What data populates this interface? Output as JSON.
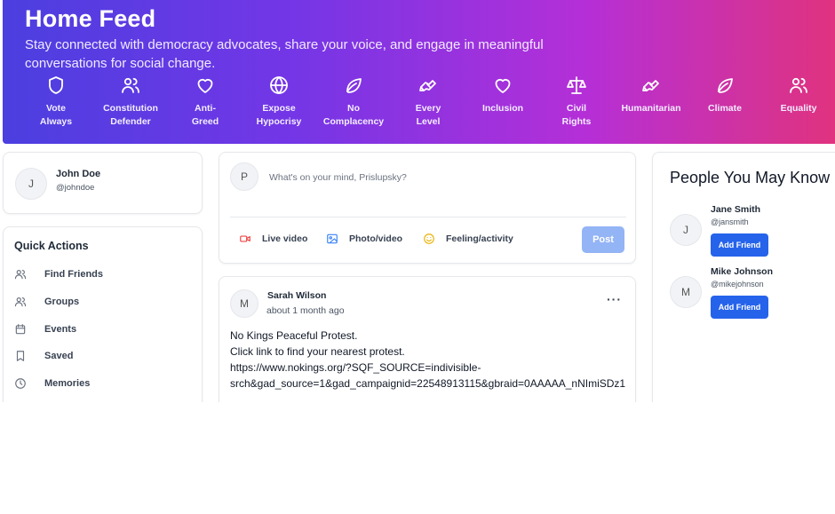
{
  "header": {
    "title": "Home Feed",
    "subtitle": "Stay connected with democracy advocates, share your voice, and engage in meaningful conversations for social change."
  },
  "categories": [
    {
      "label": "Vote\nAlways",
      "icon": "shield-icon"
    },
    {
      "label": "Constitution\nDefender",
      "icon": "users-icon"
    },
    {
      "label": "Anti-\nGreed",
      "icon": "heart-icon"
    },
    {
      "label": "Expose\nHypocrisy",
      "icon": "globe-icon"
    },
    {
      "label": "No\nComplacency",
      "icon": "leaf-icon"
    },
    {
      "label": "Every\nLevel",
      "icon": "handshake-icon"
    },
    {
      "label": "Inclusion",
      "icon": "heart-icon"
    },
    {
      "label": "Civil\nRights",
      "icon": "scale-icon"
    },
    {
      "label": "Humanitarian",
      "icon": "handshake-icon"
    },
    {
      "label": "Climate",
      "icon": "leaf-icon"
    },
    {
      "label": "Equality",
      "icon": "users-icon"
    }
  ],
  "profile": {
    "initial": "J",
    "name": "John Doe",
    "handle": "@johndoe"
  },
  "quick_actions": {
    "title": "Quick Actions",
    "items": [
      {
        "label": "Find Friends",
        "icon": "users-icon"
      },
      {
        "label": "Groups",
        "icon": "users-icon"
      },
      {
        "label": "Events",
        "icon": "calendar-icon"
      },
      {
        "label": "Saved",
        "icon": "bookmark-icon"
      },
      {
        "label": "Memories",
        "icon": "clock-icon"
      }
    ]
  },
  "composer": {
    "initial": "P",
    "placeholder": "What's on your mind, Prislupsky?",
    "actions": [
      {
        "label": "Live video",
        "icon": "video-icon",
        "color": "#ef4444"
      },
      {
        "label": "Photo/video",
        "icon": "image-icon",
        "color": "#3b82f6"
      },
      {
        "label": "Feeling/activity",
        "icon": "smile-icon",
        "color": "#eab308"
      }
    ],
    "post_label": "Post"
  },
  "post": {
    "initial": "M",
    "author": "Sarah Wilson",
    "time": "about 1 month ago",
    "more": "···",
    "lines": [
      "No Kings Peaceful Protest.",
      "Click link to find your nearest protest.",
      "https://www.nokings.org/?SQF_SOURCE=indivisible-",
      "srch&gad_source=1&gad_campaignid=22548913115&gbraid=0AAAAA_nNImiSDz1"
    ]
  },
  "people_you_may_know": {
    "title": "People You May Know",
    "people": [
      {
        "initial": "J",
        "name": "Jane Smith",
        "handle": "@jansmith",
        "button": "Add Friend"
      },
      {
        "initial": "M",
        "name": "Mike Johnson",
        "handle": "@mikejohnson",
        "button": "Add Friend"
      }
    ]
  },
  "colors": {
    "gradient_start": "#4b3fe0",
    "gradient_end": "#e0337f",
    "primary_button": "#2563eb",
    "post_button_disabled": "#93b4f5"
  }
}
